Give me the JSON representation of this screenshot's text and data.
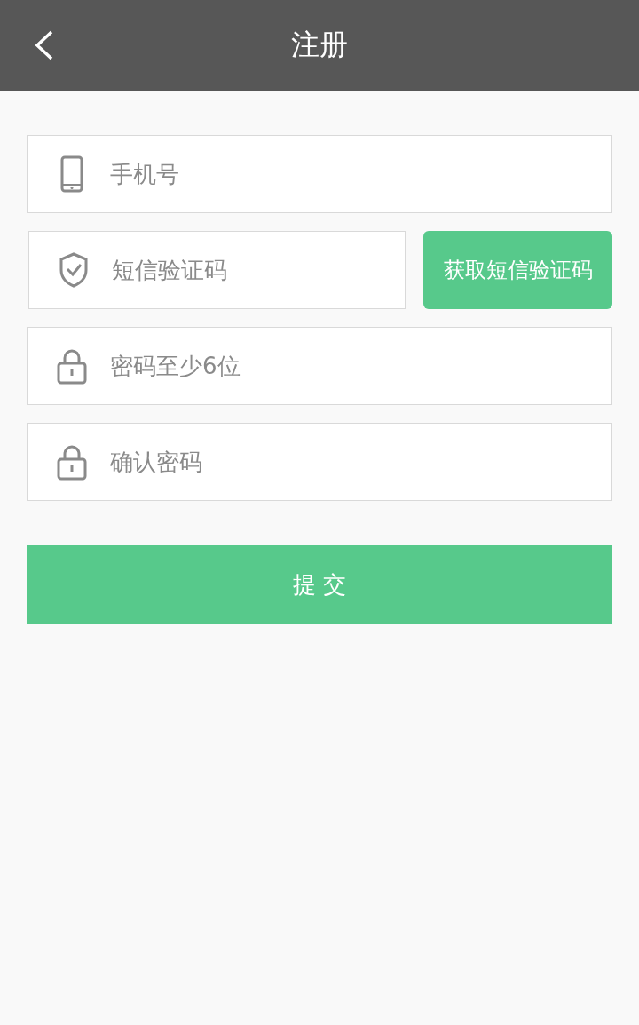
{
  "header": {
    "title": "注册"
  },
  "fields": [
    {
      "kind": "phone",
      "placeholder": "手机号"
    },
    {
      "kind": "code",
      "placeholder": "短信验证码",
      "button": "获取短信验证码"
    },
    {
      "kind": "password",
      "placeholder": "密码至少6位"
    },
    {
      "kind": "password",
      "placeholder": "确认密码"
    }
  ],
  "submit": "提 交"
}
